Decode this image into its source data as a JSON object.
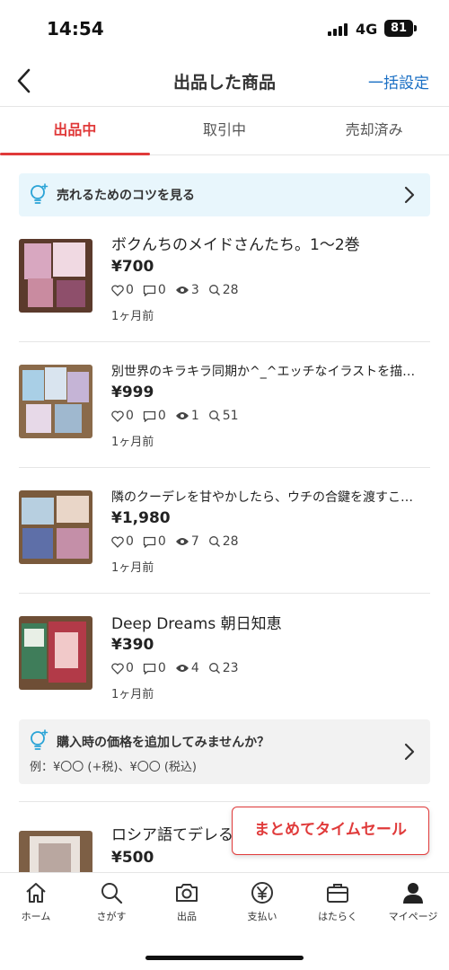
{
  "status_bar": {
    "time": "14:54",
    "network": "4G",
    "battery": "81"
  },
  "header": {
    "title": "出品した商品",
    "bulk_setting": "一括設定"
  },
  "tabs": [
    {
      "label": "出品中",
      "active": true
    },
    {
      "label": "取引中",
      "active": false
    },
    {
      "label": "売却済み",
      "active": false
    }
  ],
  "tips_banner": {
    "text": "売れるためのコツを見る"
  },
  "items": [
    {
      "title": "ボクんちのメイドさんたち。1～2巻",
      "price": "¥700",
      "likes": "0",
      "comments": "0",
      "views": "3",
      "searches": "28",
      "time": "1ヶ月前"
    },
    {
      "title": "別世界のキラキラ同期か^_^エッチなイラストを描…",
      "price": "¥999",
      "likes": "0",
      "comments": "0",
      "views": "1",
      "searches": "51",
      "time": "1ヶ月前"
    },
    {
      "title": "隣のクーデレを甘やかしたら、ウチの合鍵を渡すこ…",
      "price": "¥1,980",
      "likes": "0",
      "comments": "0",
      "views": "7",
      "searches": "28",
      "time": "1ヶ月前"
    },
    {
      "title": "Deep Dreams 朝日知恵",
      "price": "¥390",
      "likes": "0",
      "comments": "0",
      "views": "4",
      "searches": "23",
      "time": "1ヶ月前"
    },
    {
      "title": "ロシア語てデレる",
      "price": "¥500"
    }
  ],
  "price_banner": {
    "title": "購入時の価格を追加してみませんか？",
    "subtitle": "例：¥〇〇 (+税)、¥〇〇 (税込)"
  },
  "sale_button": {
    "label": "まとめてタイムセール"
  },
  "tabbar": [
    {
      "label": "ホーム",
      "icon": "home-icon"
    },
    {
      "label": "さがす",
      "icon": "search-icon"
    },
    {
      "label": "出品",
      "icon": "camera-icon"
    },
    {
      "label": "支払い",
      "icon": "yen-icon"
    },
    {
      "label": "はたらく",
      "icon": "briefcase-icon"
    },
    {
      "label": "マイページ",
      "icon": "person-icon"
    }
  ],
  "colors": {
    "accent": "#e03a3a",
    "link": "#1a6fc4",
    "tips_bg": "#e8f6fc"
  }
}
